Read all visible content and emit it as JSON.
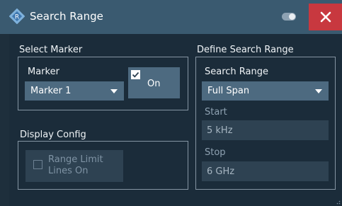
{
  "window": {
    "title": "Search Range",
    "close_label": "✕"
  },
  "select_marker": {
    "group_label": "Select Marker",
    "marker_label": "Marker",
    "marker_value": "Marker 1",
    "on_label": "On",
    "on_checked": true
  },
  "display_config": {
    "group_label": "Display Config",
    "range_limit_label": "Range Limit Lines On",
    "range_limit_checked": false,
    "enabled": false
  },
  "define_search_range": {
    "group_label": "Define Search Range",
    "search_range_label": "Search Range",
    "search_range_value": "Full Span",
    "start_label": "Start",
    "start_value": "5 kHz",
    "stop_label": "Stop",
    "stop_value": "6 GHz"
  },
  "colors": {
    "accent": "#3a5a70",
    "close": "#c8383f",
    "field": "#4d6a80",
    "disabled_field": "#2e4252"
  },
  "icons": {
    "logo": "rohde-schwarz-logo-icon",
    "toggle": "toggle-icon",
    "close": "close-icon",
    "check": "check-icon",
    "dropdown": "chevron-down-icon"
  }
}
